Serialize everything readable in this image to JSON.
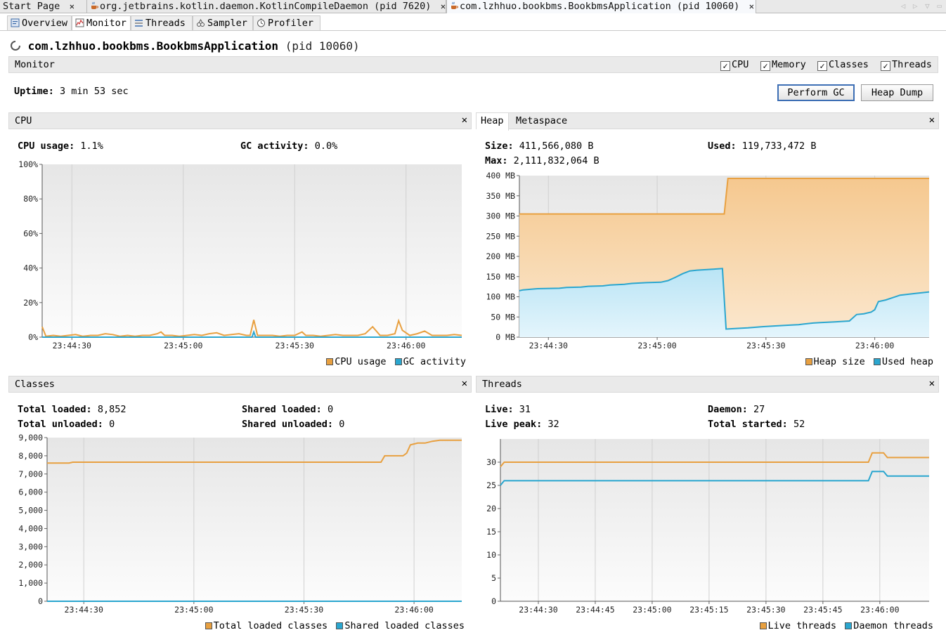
{
  "doc_tabs": [
    {
      "label": "Start Page"
    },
    {
      "label": "org.jetbrains.kotlin.daemon.KotlinCompileDaemon (pid 7620)"
    },
    {
      "label": "com.lzhhuo.bookbms.BookbmsApplication (pid 10060)"
    }
  ],
  "view_tabs": [
    {
      "label": "Overview",
      "icon": "overview-icon"
    },
    {
      "label": "Monitor",
      "icon": "monitor-icon"
    },
    {
      "label": "Threads",
      "icon": "threads-icon"
    },
    {
      "label": "Sampler",
      "icon": "sampler-icon"
    },
    {
      "label": "Profiler",
      "icon": "profiler-icon"
    }
  ],
  "app": {
    "name": "com.lzhhuo.bookbms.BookbmsApplication",
    "pid": "(pid 10060)"
  },
  "monitor": {
    "label": "Monitor",
    "checkboxes": [
      {
        "label": "CPU",
        "checked": true
      },
      {
        "label": "Memory",
        "checked": true
      },
      {
        "label": "Classes",
        "checked": true
      },
      {
        "label": "Threads",
        "checked": true
      }
    ],
    "uptime_label": "Uptime:",
    "uptime_value": "3 min 53 sec",
    "perform_gc": "Perform GC",
    "heap_dump": "Heap Dump"
  },
  "cpu": {
    "title": "CPU",
    "usage_label": "CPU usage:",
    "usage_value": "1.1%",
    "gc_label": "GC activity:",
    "gc_value": "0.0%",
    "legend": [
      "CPU usage",
      "GC activity"
    ]
  },
  "heap": {
    "tabs": [
      "Heap",
      "Metaspace"
    ],
    "size_label": "Size:",
    "size_value": "411,566,080 B",
    "used_label": "Used:",
    "used_value": "119,733,472 B",
    "max_label": "Max:",
    "max_value": "2,111,832,064 B",
    "legend": [
      "Heap size",
      "Used heap"
    ]
  },
  "classes": {
    "title": "Classes",
    "total_loaded_label": "Total loaded:",
    "total_loaded_value": "8,852",
    "total_unloaded_label": "Total unloaded:",
    "total_unloaded_value": "0",
    "shared_loaded_label": "Shared loaded:",
    "shared_loaded_value": "0",
    "shared_unloaded_label": "Shared unloaded:",
    "shared_unloaded_value": "0",
    "legend": [
      "Total loaded classes",
      "Shared loaded classes"
    ]
  },
  "threads": {
    "title": "Threads",
    "live_label": "Live:",
    "live_value": "31",
    "daemon_label": "Daemon:",
    "daemon_value": "27",
    "peak_label": "Live peak:",
    "peak_value": "32",
    "started_label": "Total started:",
    "started_value": "52",
    "legend": [
      "Live threads",
      "Daemon threads"
    ]
  },
  "colors": {
    "orange": "#e8a040",
    "blue": "#2aa6cf"
  },
  "chart_data": [
    {
      "type": "line",
      "name": "cpu",
      "ylim": [
        0,
        100
      ],
      "yticks": [
        "0%",
        "20%",
        "40%",
        "60%",
        "80%",
        "100%"
      ],
      "xtick_labels": [
        "23:44:30",
        "23:45:00",
        "23:45:30",
        "23:46:00"
      ],
      "xlim": [
        0,
        113
      ],
      "xtick_positions": [
        8,
        38,
        68,
        98
      ],
      "series": [
        {
          "name": "CPU usage",
          "color": "#e8a040",
          "points": [
            [
              0,
              6
            ],
            [
              1,
              0.5
            ],
            [
              3,
              1
            ],
            [
              5,
              0.5
            ],
            [
              7,
              1
            ],
            [
              9,
              1.5
            ],
            [
              11,
              0.5
            ],
            [
              13,
              1
            ],
            [
              15,
              1
            ],
            [
              17,
              2
            ],
            [
              19,
              1.5
            ],
            [
              21,
              0.5
            ],
            [
              23,
              1
            ],
            [
              25,
              0.5
            ],
            [
              27,
              1
            ],
            [
              29,
              1
            ],
            [
              31,
              2
            ],
            [
              32,
              3
            ],
            [
              33,
              1
            ],
            [
              35,
              1
            ],
            [
              37,
              0.5
            ],
            [
              39,
              1
            ],
            [
              41,
              1.5
            ],
            [
              43,
              1
            ],
            [
              45,
              2
            ],
            [
              47,
              2.5
            ],
            [
              49,
              1
            ],
            [
              51,
              1.5
            ],
            [
              53,
              2
            ],
            [
              55,
              1
            ],
            [
              56,
              1
            ],
            [
              57,
              10
            ],
            [
              58,
              1
            ],
            [
              60,
              1
            ],
            [
              62,
              1
            ],
            [
              64,
              0.5
            ],
            [
              66,
              1
            ],
            [
              68,
              1
            ],
            [
              70,
              3
            ],
            [
              71,
              1
            ],
            [
              73,
              1
            ],
            [
              75,
              0.5
            ],
            [
              77,
              1
            ],
            [
              79,
              1.5
            ],
            [
              81,
              1
            ],
            [
              83,
              1
            ],
            [
              85,
              1
            ],
            [
              87,
              2
            ],
            [
              89,
              6
            ],
            [
              91,
              1
            ],
            [
              93,
              1
            ],
            [
              95,
              2
            ],
            [
              96,
              9.5
            ],
            [
              97,
              4
            ],
            [
              99,
              1
            ],
            [
              101,
              2
            ],
            [
              103,
              3.5
            ],
            [
              105,
              1
            ],
            [
              107,
              1
            ],
            [
              109,
              1
            ],
            [
              111,
              1.5
            ],
            [
              113,
              1
            ]
          ]
        },
        {
          "name": "GC activity",
          "color": "#2aa6cf",
          "points": [
            [
              0,
              0
            ],
            [
              55,
              0
            ],
            [
              56.5,
              0
            ],
            [
              57,
              3
            ],
            [
              57.5,
              0
            ],
            [
              113,
              0
            ]
          ]
        }
      ]
    },
    {
      "type": "area",
      "name": "heap",
      "ylim": [
        0,
        400
      ],
      "yticks": [
        "0 MB",
        "50 MB",
        "100 MB",
        "150 MB",
        "200 MB",
        "250 MB",
        "300 MB",
        "350 MB",
        "400 MB"
      ],
      "xtick_labels": [
        "23:44:30",
        "23:45:00",
        "23:45:30",
        "23:46:00"
      ],
      "xlim": [
        0,
        113
      ],
      "xtick_positions": [
        8,
        38,
        68,
        98
      ],
      "series": [
        {
          "name": "Heap size",
          "color": "#e8a040",
          "points": [
            [
              0,
              305
            ],
            [
              56.5,
              305
            ],
            [
              57.5,
              393
            ],
            [
              113,
              393
            ]
          ]
        },
        {
          "name": "Used heap",
          "color": "#2aa6cf",
          "points": [
            [
              0,
              115
            ],
            [
              1,
              117
            ],
            [
              5,
              120
            ],
            [
              11,
              121
            ],
            [
              13,
              123
            ],
            [
              17,
              124
            ],
            [
              19,
              126
            ],
            [
              23,
              127
            ],
            [
              25,
              129
            ],
            [
              29,
              131
            ],
            [
              31,
              133
            ],
            [
              35,
              135
            ],
            [
              39,
              136
            ],
            [
              41,
              140
            ],
            [
              43,
              148
            ],
            [
              45,
              157
            ],
            [
              47,
              164
            ],
            [
              49,
              166
            ],
            [
              53,
              168
            ],
            [
              56,
              170
            ],
            [
              57,
              20
            ],
            [
              59,
              21
            ],
            [
              63,
              23
            ],
            [
              67,
              26
            ],
            [
              71,
              28
            ],
            [
              75,
              30
            ],
            [
              77,
              31
            ],
            [
              79,
              33
            ],
            [
              81,
              35
            ],
            [
              83,
              36
            ],
            [
              85,
              37
            ],
            [
              87,
              38
            ],
            [
              89,
              39
            ],
            [
              91,
              40
            ],
            [
              93,
              56
            ],
            [
              95,
              58
            ],
            [
              97,
              62
            ],
            [
              98,
              68
            ],
            [
              99,
              88
            ],
            [
              101,
              92
            ],
            [
              103,
              98
            ],
            [
              105,
              104
            ],
            [
              109,
              108
            ],
            [
              113,
              112
            ]
          ]
        }
      ]
    },
    {
      "type": "line",
      "name": "classes",
      "ylim": [
        0,
        9000
      ],
      "yticks": [
        "0",
        "1,000",
        "2,000",
        "3,000",
        "4,000",
        "5,000",
        "6,000",
        "7,000",
        "8,000",
        "9,000"
      ],
      "xtick_labels": [
        "23:44:30",
        "23:45:00",
        "23:45:30",
        "23:46:00"
      ],
      "xlim": [
        0,
        113
      ],
      "xtick_positions": [
        10,
        40,
        70,
        100
      ],
      "series": [
        {
          "name": "Total loaded classes",
          "color": "#e8a040",
          "points": [
            [
              0,
              7600
            ],
            [
              6,
              7600
            ],
            [
              7,
              7650
            ],
            [
              91,
              7650
            ],
            [
              92,
              8000
            ],
            [
              97,
              8000
            ],
            [
              98,
              8150
            ],
            [
              99,
              8600
            ],
            [
              101,
              8700
            ],
            [
              103,
              8700
            ],
            [
              105,
              8800
            ],
            [
              107,
              8852
            ],
            [
              113,
              8852
            ]
          ]
        },
        {
          "name": "Shared loaded classes",
          "color": "#2aa6cf",
          "points": [
            [
              0,
              0
            ],
            [
              113,
              0
            ]
          ]
        }
      ]
    },
    {
      "type": "line",
      "name": "threads",
      "ylim": [
        0,
        35
      ],
      "yticks": [
        "0",
        "5",
        "10",
        "15",
        "20",
        "25",
        "30"
      ],
      "xtick_labels": [
        "23:44:30",
        "23:44:45",
        "23:45:00",
        "23:45:15",
        "23:45:30",
        "23:45:45",
        "23:46:00"
      ],
      "xlim": [
        0,
        113
      ],
      "xtick_positions": [
        10,
        25,
        40,
        55,
        70,
        85,
        100
      ],
      "series": [
        {
          "name": "Live threads",
          "color": "#e8a040",
          "points": [
            [
              0,
              29
            ],
            [
              1,
              30
            ],
            [
              97,
              30
            ],
            [
              98,
              32
            ],
            [
              101,
              32
            ],
            [
              102,
              31
            ],
            [
              113,
              31
            ]
          ]
        },
        {
          "name": "Daemon threads",
          "color": "#2aa6cf",
          "points": [
            [
              0,
              25
            ],
            [
              1,
              26
            ],
            [
              97,
              26
            ],
            [
              98,
              28
            ],
            [
              101,
              28
            ],
            [
              102,
              27
            ],
            [
              113,
              27
            ]
          ]
        }
      ]
    }
  ]
}
